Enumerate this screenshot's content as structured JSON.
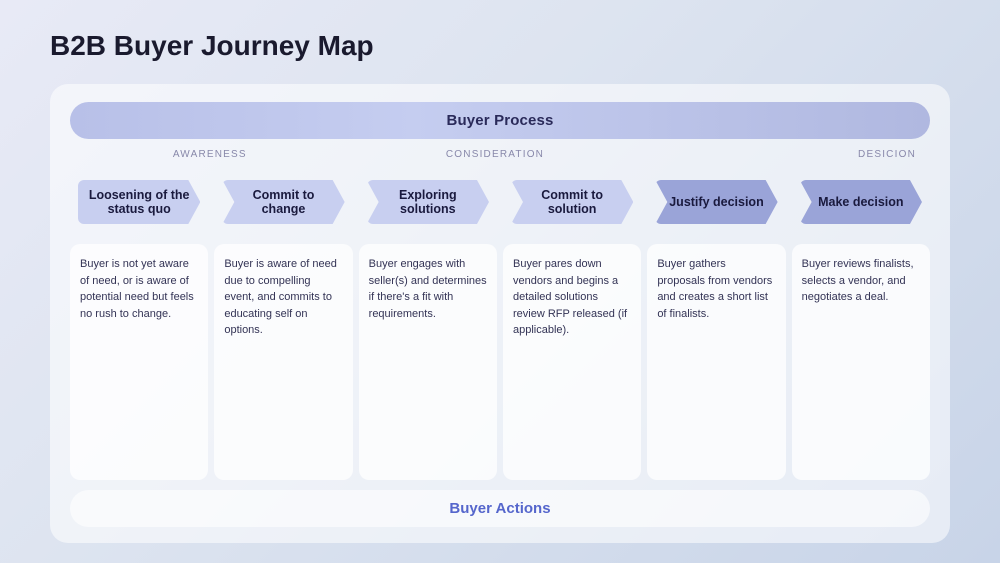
{
  "title": "B2B Buyer Journey Map",
  "buyer_process_label": "Buyer Process",
  "buyer_actions_label": "Buyer Actions",
  "stage_labels": {
    "awareness": "AWARENESS",
    "consideration": "CONSIDERATION",
    "decision": "DESICION"
  },
  "steps": [
    {
      "id": "loosening",
      "label": "Loosening of the status quo",
      "darker": false,
      "first": true,
      "description": "Buyer is not yet aware of need, or is aware of potential need but feels no rush to change."
    },
    {
      "id": "commit-change",
      "label": "Commit to change",
      "darker": false,
      "first": false,
      "description": "Buyer is aware of need due to compelling event, and commits to educating self on options."
    },
    {
      "id": "exploring",
      "label": "Exploring solutions",
      "darker": false,
      "first": false,
      "description": "Buyer engages with seller(s) and determines if there's a fit with requirements."
    },
    {
      "id": "commit-solution",
      "label": "Commit to solution",
      "darker": false,
      "first": false,
      "description": "Buyer pares down vendors and begins a detailed solutions review RFP released (if applicable)."
    },
    {
      "id": "justify",
      "label": "Justify decision",
      "darker": true,
      "first": false,
      "description": "Buyer gathers proposals from vendors and creates a short list of finalists."
    },
    {
      "id": "make-decision",
      "label": "Make decision",
      "darker": true,
      "first": false,
      "description": "Buyer reviews finalists, selects a vendor, and negotiates a deal."
    }
  ]
}
